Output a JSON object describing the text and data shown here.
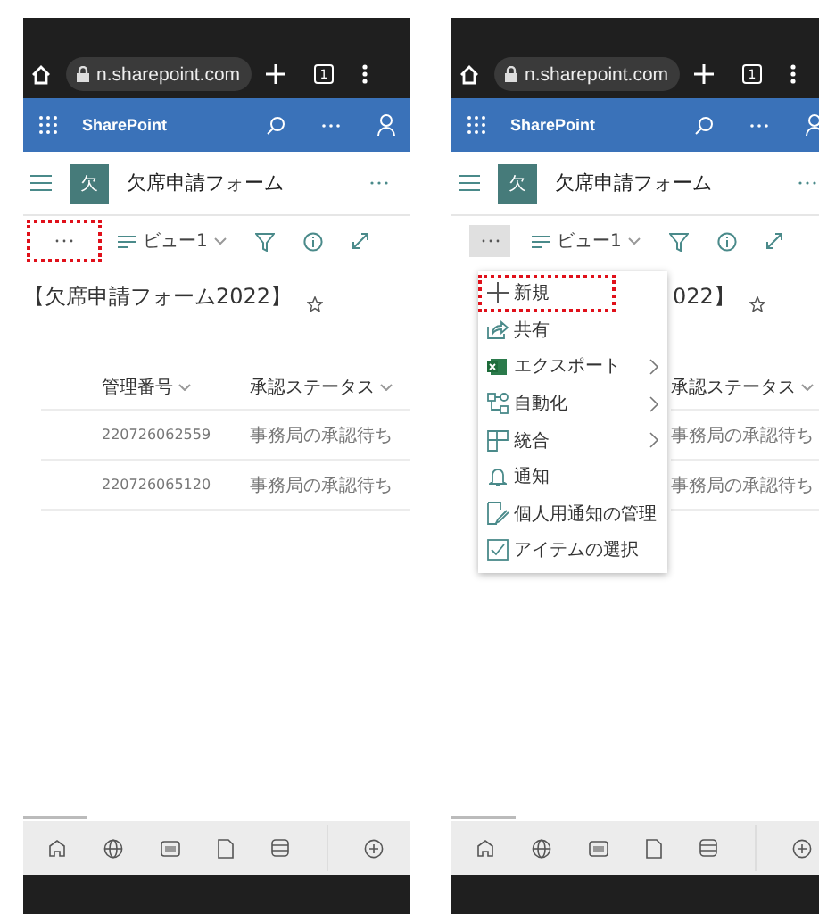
{
  "phones": [
    {
      "browser": {
        "url": "n.sharepoint.com",
        "tab_count": "1"
      },
      "app_name": "SharePoint",
      "site": {
        "initial": "欠",
        "title": "欠席申請フォーム"
      },
      "command_bar": {
        "more_highlighted": true,
        "more_pressed": false,
        "view": "ビュー1"
      },
      "page_title": "【欠席申請フォーム2022】",
      "table": {
        "columns": [
          "管理番号",
          "承認ステータス"
        ],
        "rows": [
          [
            "220726062559",
            "事務局の承認待ち"
          ],
          [
            "220726065120",
            "事務局の承認待ち"
          ]
        ]
      }
    },
    {
      "browser": {
        "url": "n.sharepoint.com",
        "tab_count": "1"
      },
      "app_name": "SharePoint",
      "site": {
        "initial": "欠",
        "title": "欠席申請フォーム"
      },
      "command_bar": {
        "more_highlighted": false,
        "more_pressed": true,
        "view": "ビュー1"
      },
      "page_title": "022】",
      "table": {
        "columns": [
          "承認ステータス"
        ],
        "rows": [
          [
            "事務局の承認待ち"
          ],
          [
            "事務局の承認待ち"
          ]
        ]
      },
      "menu": {
        "items": [
          {
            "label": "新規",
            "submenu": false,
            "highlighted": true
          },
          {
            "label": "共有",
            "submenu": false,
            "highlighted": false
          },
          {
            "label": "エクスポート",
            "submenu": true,
            "highlighted": false
          },
          {
            "label": "自動化",
            "submenu": true,
            "highlighted": false
          },
          {
            "label": "統合",
            "submenu": true,
            "highlighted": false
          },
          {
            "label": "通知",
            "submenu": false,
            "highlighted": false
          },
          {
            "label": "個人用通知の管理",
            "submenu": false,
            "highlighted": false
          },
          {
            "label": "アイテムの選択",
            "submenu": false,
            "highlighted": false
          }
        ]
      }
    }
  ]
}
